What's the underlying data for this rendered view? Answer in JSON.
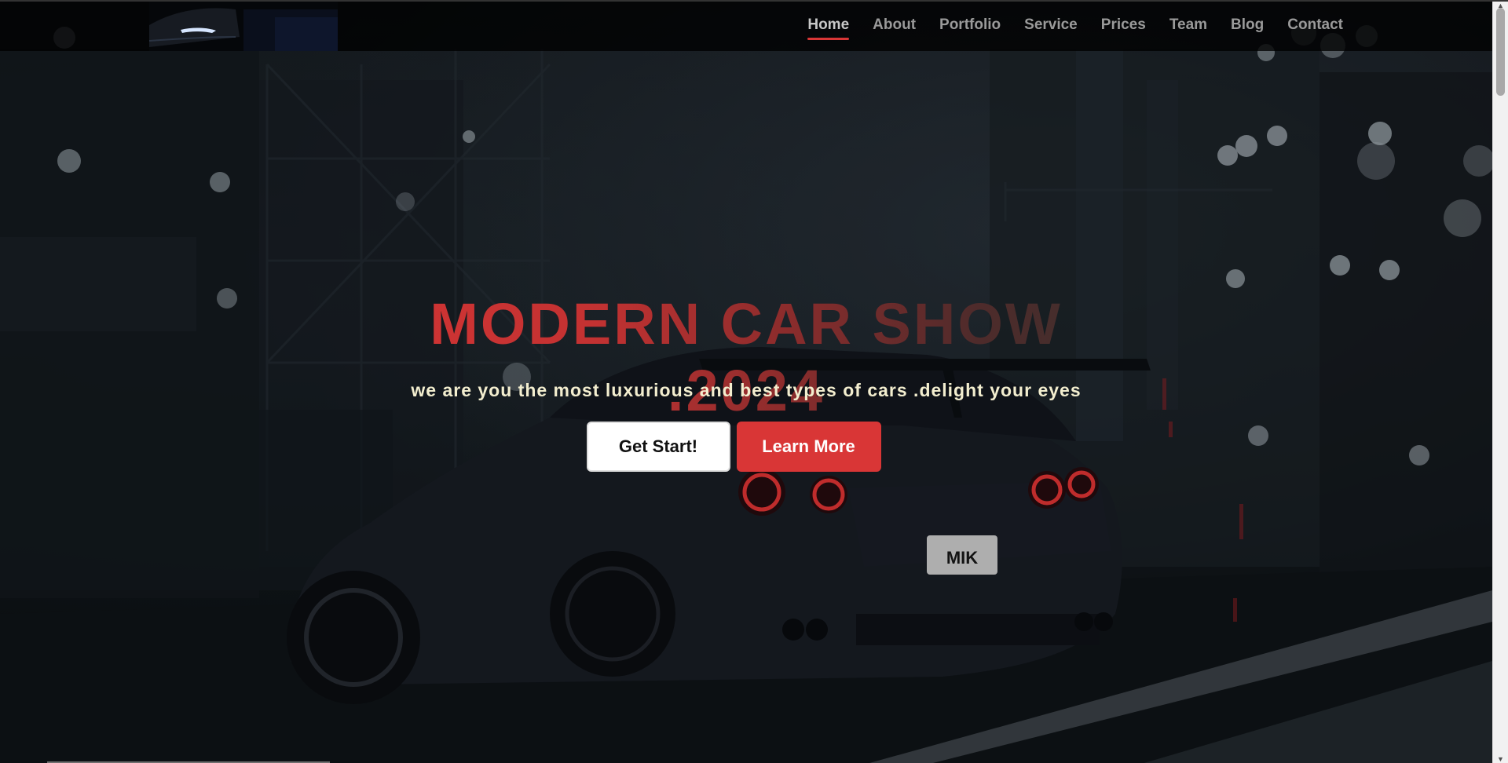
{
  "nav": {
    "items": [
      {
        "label": "Home",
        "active": true
      },
      {
        "label": "About",
        "active": false
      },
      {
        "label": "Portfolio",
        "active": false
      },
      {
        "label": "Service",
        "active": false
      },
      {
        "label": "Prices",
        "active": false
      },
      {
        "label": "Team",
        "active": false
      },
      {
        "label": "Blog",
        "active": false
      },
      {
        "label": "Contact",
        "active": false
      }
    ]
  },
  "hero": {
    "title": "MODERN CAR SHOW .2024",
    "subtitle": "we are you the most luxurious and best types of cars .delight your eyes",
    "buttons": {
      "start_label": "Get Start!",
      "learn_label": "Learn More"
    },
    "license_plate": "MIK"
  },
  "colors": {
    "accent": "#d93636",
    "nav_text": "#9a9a9a",
    "subtitle": "#f3eecf"
  },
  "icons": {
    "logo": "car-headlight-logo",
    "scroll_up": "chevron-up-icon",
    "scroll_down": "chevron-down-icon"
  }
}
